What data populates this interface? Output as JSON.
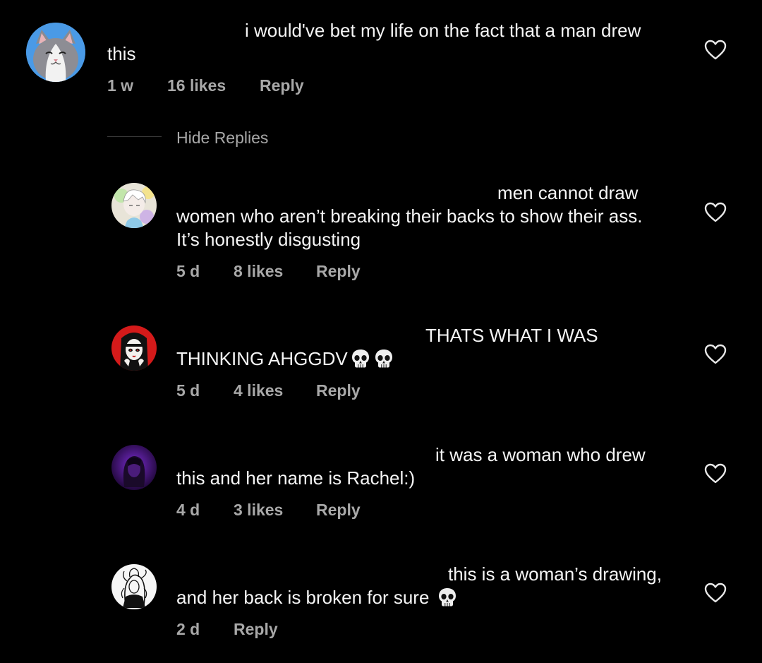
{
  "main_comment": {
    "line1": "i would've bet my life on the fact that a man drew",
    "line2": "this",
    "time": "1 w",
    "likes": "16 likes",
    "reply": "Reply"
  },
  "hide_replies": "Hide Replies",
  "replies": [
    {
      "line1": "men cannot draw",
      "line2": "women who aren’t breaking their backs to show their ass.",
      "line3": "It’s honestly disgusting",
      "time": "5 d",
      "likes": "8 likes",
      "reply": "Reply"
    },
    {
      "line1": "THATS WHAT I WAS",
      "line2": "THINKING AHGGDV",
      "line2_emoji": [
        "skull-emoji",
        "skull-emoji"
      ],
      "time": "5 d",
      "likes": "4 likes",
      "reply": "Reply"
    },
    {
      "line1": "it was a woman who drew",
      "line2": "this and her name is Rachel:)",
      "time": "4 d",
      "likes": "3 likes",
      "reply": "Reply"
    },
    {
      "line1": "this is a woman’s drawing,",
      "line2": "and her back is broken for sure",
      "line2_emoji": [
        "skull-emoji"
      ],
      "time": "2 d",
      "reply": "Reply"
    }
  ],
  "icons": {
    "like": "heart-outline-icon"
  },
  "colors": {
    "background": "#000000",
    "text": "#f5f5f5",
    "meta": "#a8a8a8"
  }
}
